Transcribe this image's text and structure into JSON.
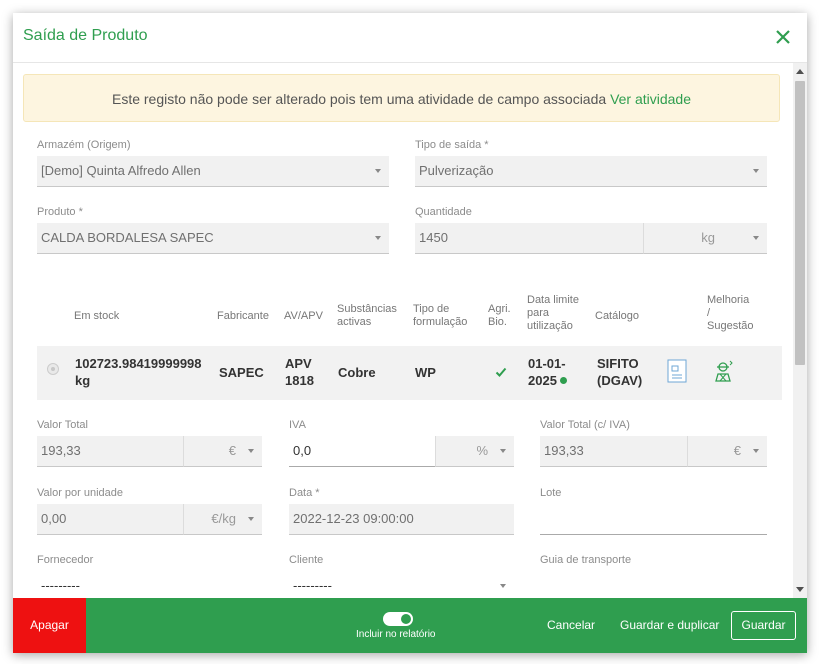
{
  "modal": {
    "title": "Saída de Produto"
  },
  "banner": {
    "text": "Este registo não pode ser alterado pois tem uma atividade de campo associada",
    "link": "Ver atividade"
  },
  "form": {
    "armazem": {
      "label": "Armazém (Origem)",
      "value": "[Demo] Quinta Alfredo Allen"
    },
    "tipo_saida": {
      "label": "Tipo de saída *",
      "value": "Pulverização"
    },
    "produto": {
      "label": "Produto *",
      "value": "CALDA BORDALESA SAPEC"
    },
    "quantidade": {
      "label": "Quantidade",
      "value": "1450",
      "unit": "kg"
    },
    "valor_total": {
      "label": "Valor Total",
      "value": "193,33",
      "unit": "€"
    },
    "iva": {
      "label": "IVA",
      "value": "0,0",
      "unit": "%"
    },
    "valor_total_iva": {
      "label": "Valor Total (c/ IVA)",
      "value": "193,33",
      "unit": "€"
    },
    "valor_unidade": {
      "label": "Valor por unidade",
      "value": "0,00",
      "unit": "€/kg"
    },
    "data": {
      "label": "Data *",
      "value": "2022-12-23 09:00:00"
    },
    "lote": {
      "label": "Lote",
      "value": ""
    },
    "fornecedor": {
      "label": "Fornecedor",
      "value": "---------"
    },
    "cliente": {
      "label": "Cliente",
      "value": "---------"
    },
    "guia": {
      "label": "Guia de transporte",
      "value": ""
    }
  },
  "table": {
    "headers": {
      "stock": "Em stock",
      "fabricante": "Fabricante",
      "av": "AV/APV",
      "subst_1": "Substâncias",
      "subst_2": "activas",
      "tipo_1": "Tipo de",
      "tipo_2": "formulação",
      "agri_1": "Agri.",
      "agri_2": "Bio.",
      "data_1": "Data limite",
      "data_2": "para",
      "data_3": "utilização",
      "catalogo": "Catálogo",
      "melhoria_1": "Melhoria",
      "melhoria_2": "/",
      "melhoria_3": "Sugestão"
    },
    "row": {
      "stock_1": "102723.98419999998",
      "stock_2": "kg",
      "fabricante": "SAPEC",
      "av_1": "APV",
      "av_2": "1818",
      "substancias": "Cobre",
      "tipo": "WP",
      "data_1": "01-01-",
      "data_2": "2025",
      "catalogo_1": "SIFITO",
      "catalogo_2": "(DGAV)"
    }
  },
  "footer": {
    "delete": "Apagar",
    "toggle_label": "Incluir no relatório",
    "cancel": "Cancelar",
    "save_duplicate": "Guardar e duplicar",
    "save": "Guardar"
  },
  "colors": {
    "accent": "#2f9e4f",
    "danger": "#ee1111",
    "banner_bg": "#fdf5e0"
  }
}
